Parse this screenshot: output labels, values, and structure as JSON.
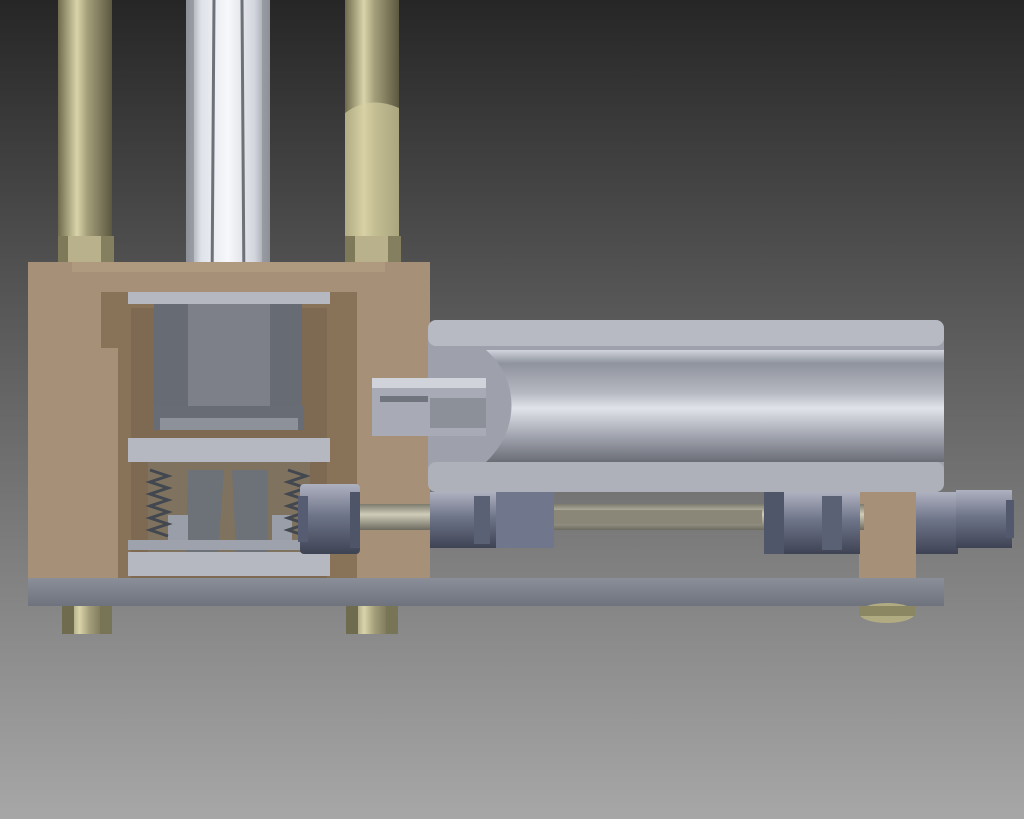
{
  "viewport": {
    "background_top": "#262626",
    "background_bottom": "#a7a7a7"
  },
  "colors": {
    "housing": "#a69077",
    "housing_shadow": "#887359",
    "housing_highlight": "#c0ab8f",
    "steel": "#7d8089",
    "steel_light": "#c3c6ce",
    "steel_mid": "#9da0aa",
    "steel_dark": "#5f636b",
    "olive": "#a39e79",
    "olive_light": "#d9d4aa",
    "olive_dark": "#6e6a4c",
    "glass": "#dfe2e9",
    "glass_edge": "#8b8f98",
    "base": "#7d818c",
    "fitting": "#646b80",
    "fitting_light": "#aeb1c0"
  },
  "parts": {
    "tie_rods": 2,
    "feet": 3,
    "fittings": 4
  }
}
